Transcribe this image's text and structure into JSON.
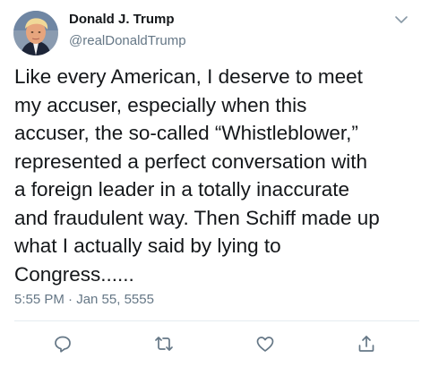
{
  "author": {
    "display_name": "Donald J. Trump",
    "handle": "@realDonaldTrump"
  },
  "tweet": {
    "text": "Like every American, I deserve to meet\nmy accuser, especially when this\naccuser, the so-called “Whistleblower,”\nrepresented a perfect conversation with\na foreign leader in a totally inaccurate\nand fraudulent way. Then Schiff made up\nwhat I actually said by lying to\nCongress......",
    "timestamp": "5:55 PM · Jan 55, 5555"
  },
  "icons": {
    "menu": "chevron-down-icon",
    "reply": "reply-icon",
    "retweet": "retweet-icon",
    "like": "heart-icon",
    "share": "share-icon"
  },
  "colors": {
    "text": "#14171a",
    "secondary": "#657786",
    "divider": "#e6ecf0"
  }
}
